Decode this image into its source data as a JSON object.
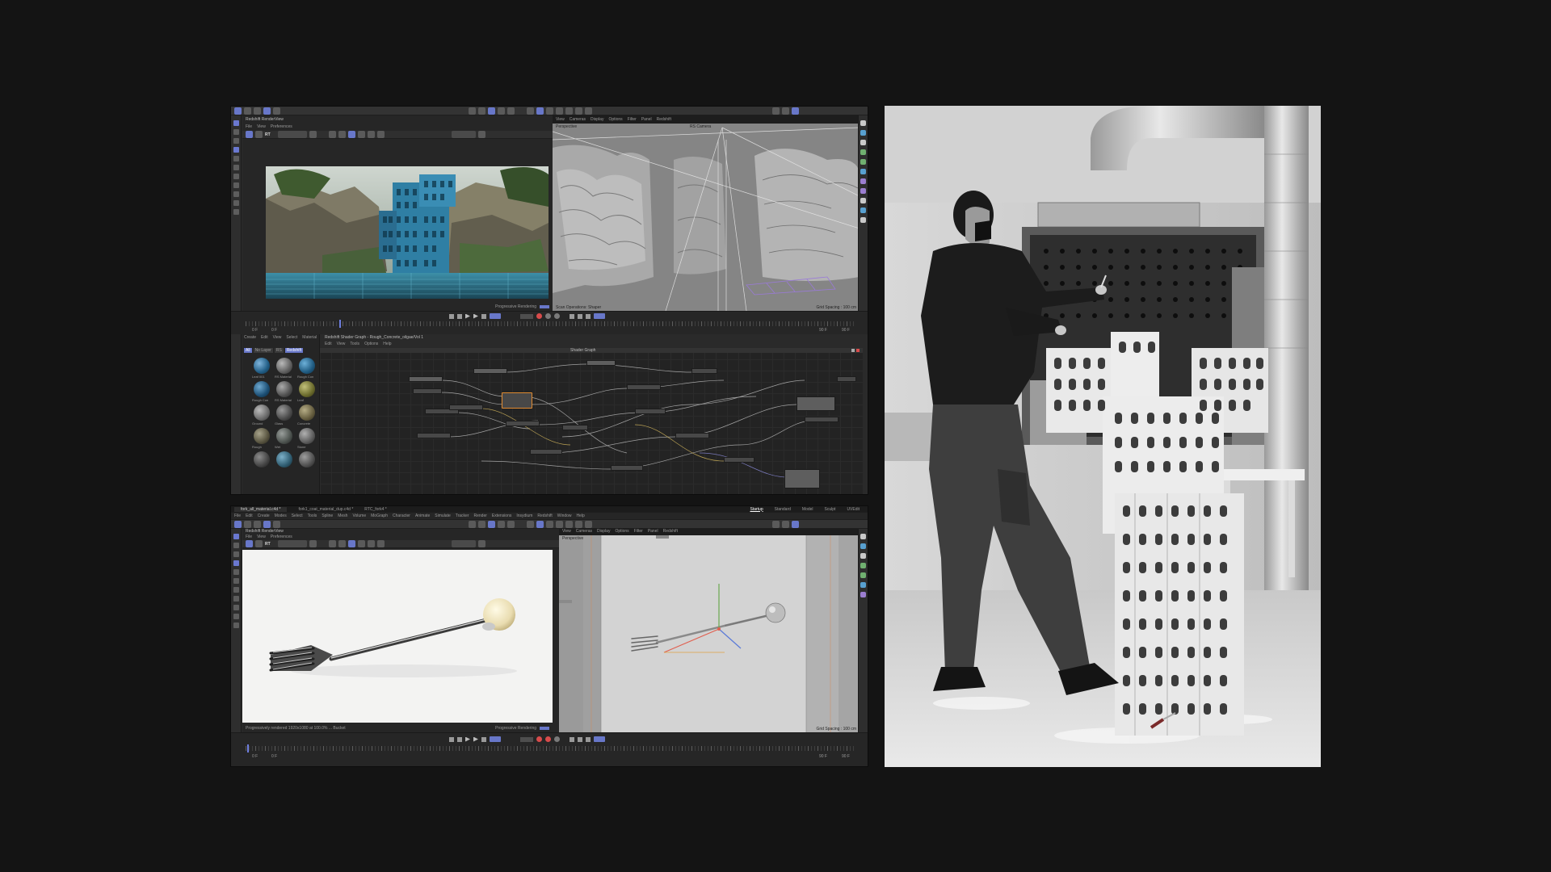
{
  "top_window": {
    "render_view": {
      "title": "Redshift RenderView",
      "menu": [
        "File",
        "View",
        "Preferences"
      ],
      "rt_label": "RT",
      "status": "Progressive Rendering"
    },
    "viewport": {
      "menu": [
        "View",
        "Cameras",
        "Display",
        "Options",
        "Filter",
        "Panel",
        "Redshift"
      ],
      "label": "Perspective",
      "camera": "RS Camera",
      "status_left": "Scan Operations: Shaper",
      "status_right": "Grid Spacing : 100 cm"
    },
    "timeline": {
      "frame_start": "0 F",
      "frame_current": "0 F",
      "frame_end_a": "90 F",
      "frame_end_b": "90 F"
    },
    "material_manager": {
      "menu": [
        "Create",
        "Edit",
        "View",
        "Select",
        "Material"
      ],
      "tabs": [
        "All",
        "No Layer",
        "RS",
        "Redshift"
      ],
      "materials": [
        "Leaf 001",
        "RS Material",
        "Rough Con",
        "Rough Con",
        "RS Material",
        "Leaf",
        "Ground",
        "Glass",
        "Concrete",
        "Rough",
        "Wet",
        "Stone"
      ]
    },
    "shader_graph": {
      "title": "Redshift Shader Graph - Rough_Concrete_oilgae/Vol 1",
      "menu": [
        "Edit",
        "View",
        "Tools",
        "Options",
        "Help"
      ],
      "canvas_title": "Shader Graph"
    }
  },
  "bottom_window": {
    "tabs": [
      "fork_all_material.c4d *",
      "fork1_coat_material_dup.c4d *",
      "RTC_fork4 *"
    ],
    "layouts": [
      "Startup",
      "Standard",
      "Model",
      "Sculpt",
      "UVEdit"
    ],
    "menu": [
      "File",
      "Edit",
      "Create",
      "Modes",
      "Select",
      "Tools",
      "Spline",
      "Mesh",
      "Volume",
      "MoGraph",
      "Character",
      "Animate",
      "Simulate",
      "Tracker",
      "Render",
      "Extensions",
      "Insydium",
      "Redshift",
      "Window",
      "Help"
    ],
    "render_view": {
      "title": "Redshift RenderView",
      "menu": [
        "File",
        "View",
        "Preferences"
      ],
      "rt_label": "RT",
      "status": "Progressive Rendering",
      "log": "Progressively rendered 1920x1080 at 100.0% ... Bucket"
    },
    "viewport": {
      "menu": [
        "View",
        "Cameras",
        "Display",
        "Options",
        "Filter",
        "Panel",
        "Redshift"
      ],
      "label": "Perspective",
      "status_right": "Grid Spacing : 100 cm"
    },
    "timeline": {
      "frame_start": "0 F",
      "frame_current": "0 F",
      "frame_end_a": "90 F",
      "frame_end_b": "90 F"
    }
  },
  "colors": {
    "accent": "#6877c9",
    "background": "#141414",
    "panel": "#2b2b2b",
    "record": "#d84b4b"
  },
  "icons": [
    "move-icon",
    "rotate-icon",
    "scale-icon",
    "render-icon",
    "play-icon",
    "record-icon",
    "camera-icon",
    "light-icon"
  ]
}
